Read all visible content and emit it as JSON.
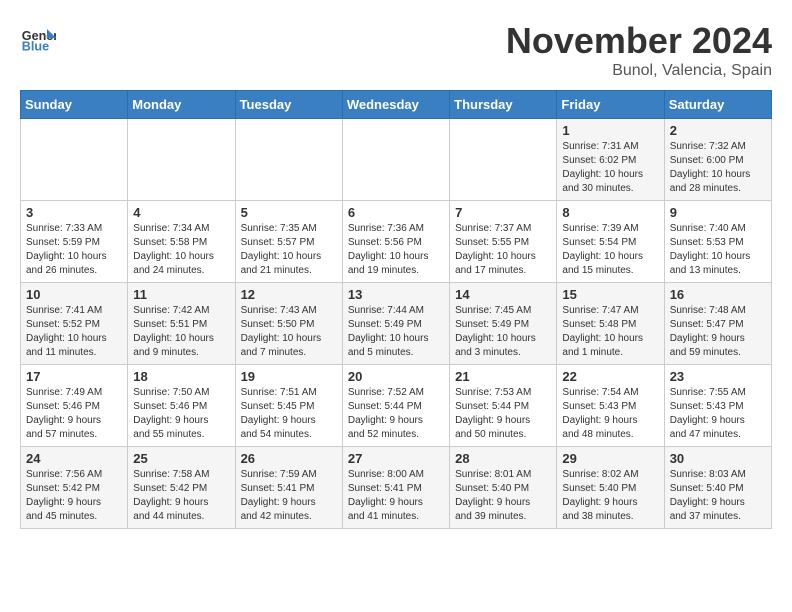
{
  "logo": {
    "general": "General",
    "blue": "Blue"
  },
  "title": "November 2024",
  "location": "Bunol, Valencia, Spain",
  "days_of_week": [
    "Sunday",
    "Monday",
    "Tuesday",
    "Wednesday",
    "Thursday",
    "Friday",
    "Saturday"
  ],
  "weeks": [
    [
      {
        "day": "",
        "info": ""
      },
      {
        "day": "",
        "info": ""
      },
      {
        "day": "",
        "info": ""
      },
      {
        "day": "",
        "info": ""
      },
      {
        "day": "",
        "info": ""
      },
      {
        "day": "1",
        "info": "Sunrise: 7:31 AM\nSunset: 6:02 PM\nDaylight: 10 hours\nand 30 minutes."
      },
      {
        "day": "2",
        "info": "Sunrise: 7:32 AM\nSunset: 6:00 PM\nDaylight: 10 hours\nand 28 minutes."
      }
    ],
    [
      {
        "day": "3",
        "info": "Sunrise: 7:33 AM\nSunset: 5:59 PM\nDaylight: 10 hours\nand 26 minutes."
      },
      {
        "day": "4",
        "info": "Sunrise: 7:34 AM\nSunset: 5:58 PM\nDaylight: 10 hours\nand 24 minutes."
      },
      {
        "day": "5",
        "info": "Sunrise: 7:35 AM\nSunset: 5:57 PM\nDaylight: 10 hours\nand 21 minutes."
      },
      {
        "day": "6",
        "info": "Sunrise: 7:36 AM\nSunset: 5:56 PM\nDaylight: 10 hours\nand 19 minutes."
      },
      {
        "day": "7",
        "info": "Sunrise: 7:37 AM\nSunset: 5:55 PM\nDaylight: 10 hours\nand 17 minutes."
      },
      {
        "day": "8",
        "info": "Sunrise: 7:39 AM\nSunset: 5:54 PM\nDaylight: 10 hours\nand 15 minutes."
      },
      {
        "day": "9",
        "info": "Sunrise: 7:40 AM\nSunset: 5:53 PM\nDaylight: 10 hours\nand 13 minutes."
      }
    ],
    [
      {
        "day": "10",
        "info": "Sunrise: 7:41 AM\nSunset: 5:52 PM\nDaylight: 10 hours\nand 11 minutes."
      },
      {
        "day": "11",
        "info": "Sunrise: 7:42 AM\nSunset: 5:51 PM\nDaylight: 10 hours\nand 9 minutes."
      },
      {
        "day": "12",
        "info": "Sunrise: 7:43 AM\nSunset: 5:50 PM\nDaylight: 10 hours\nand 7 minutes."
      },
      {
        "day": "13",
        "info": "Sunrise: 7:44 AM\nSunset: 5:49 PM\nDaylight: 10 hours\nand 5 minutes."
      },
      {
        "day": "14",
        "info": "Sunrise: 7:45 AM\nSunset: 5:49 PM\nDaylight: 10 hours\nand 3 minutes."
      },
      {
        "day": "15",
        "info": "Sunrise: 7:47 AM\nSunset: 5:48 PM\nDaylight: 10 hours\nand 1 minute."
      },
      {
        "day": "16",
        "info": "Sunrise: 7:48 AM\nSunset: 5:47 PM\nDaylight: 9 hours\nand 59 minutes."
      }
    ],
    [
      {
        "day": "17",
        "info": "Sunrise: 7:49 AM\nSunset: 5:46 PM\nDaylight: 9 hours\nand 57 minutes."
      },
      {
        "day": "18",
        "info": "Sunrise: 7:50 AM\nSunset: 5:46 PM\nDaylight: 9 hours\nand 55 minutes."
      },
      {
        "day": "19",
        "info": "Sunrise: 7:51 AM\nSunset: 5:45 PM\nDaylight: 9 hours\nand 54 minutes."
      },
      {
        "day": "20",
        "info": "Sunrise: 7:52 AM\nSunset: 5:44 PM\nDaylight: 9 hours\nand 52 minutes."
      },
      {
        "day": "21",
        "info": "Sunrise: 7:53 AM\nSunset: 5:44 PM\nDaylight: 9 hours\nand 50 minutes."
      },
      {
        "day": "22",
        "info": "Sunrise: 7:54 AM\nSunset: 5:43 PM\nDaylight: 9 hours\nand 48 minutes."
      },
      {
        "day": "23",
        "info": "Sunrise: 7:55 AM\nSunset: 5:43 PM\nDaylight: 9 hours\nand 47 minutes."
      }
    ],
    [
      {
        "day": "24",
        "info": "Sunrise: 7:56 AM\nSunset: 5:42 PM\nDaylight: 9 hours\nand 45 minutes."
      },
      {
        "day": "25",
        "info": "Sunrise: 7:58 AM\nSunset: 5:42 PM\nDaylight: 9 hours\nand 44 minutes."
      },
      {
        "day": "26",
        "info": "Sunrise: 7:59 AM\nSunset: 5:41 PM\nDaylight: 9 hours\nand 42 minutes."
      },
      {
        "day": "27",
        "info": "Sunrise: 8:00 AM\nSunset: 5:41 PM\nDaylight: 9 hours\nand 41 minutes."
      },
      {
        "day": "28",
        "info": "Sunrise: 8:01 AM\nSunset: 5:40 PM\nDaylight: 9 hours\nand 39 minutes."
      },
      {
        "day": "29",
        "info": "Sunrise: 8:02 AM\nSunset: 5:40 PM\nDaylight: 9 hours\nand 38 minutes."
      },
      {
        "day": "30",
        "info": "Sunrise: 8:03 AM\nSunset: 5:40 PM\nDaylight: 9 hours\nand 37 minutes."
      }
    ]
  ]
}
